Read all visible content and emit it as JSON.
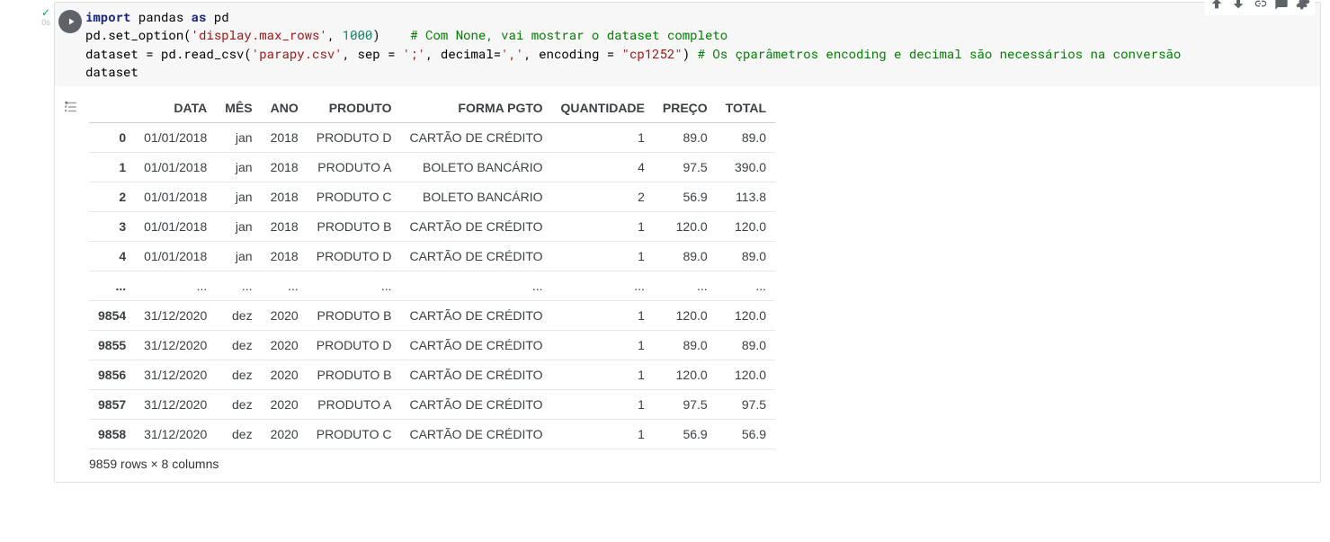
{
  "status": {
    "check": "✓",
    "duration": "0s"
  },
  "toolbar_icons": {
    "up": "arrow-up-icon",
    "down": "arrow-down-icon",
    "link": "link-icon",
    "comment": "comment-icon",
    "settings": "gear-icon"
  },
  "code": {
    "line1_a": "import",
    "line1_b": " pandas ",
    "line1_c": "as",
    "line1_d": " pd",
    "line2_a": "pd.set_option(",
    "line2_b": "'display.max_rows'",
    "line2_c": ", ",
    "line2_d": "1000",
    "line2_e": ")    ",
    "line2_f": "# Com None, vai mostrar o dataset completo",
    "line3_a": "dataset = pd.read_csv(",
    "line3_b": "'parapy.csv'",
    "line3_c": ", sep = ",
    "line3_d": "';'",
    "line3_e": ", decimal=",
    "line3_f": "','",
    "line3_g": ", encoding = ",
    "line3_h": "\"cp1252\"",
    "line3_i": ") ",
    "line3_j": "# Os çparâmetros encoding e decimal são necessários na conversão",
    "line4": "dataset"
  },
  "table": {
    "columns": [
      "",
      "DATA",
      "MÊS",
      "ANO",
      "PRODUTO",
      "FORMA PGTO",
      "QUANTIDADE",
      "PREÇO",
      "TOTAL"
    ],
    "rows": [
      {
        "idx": "0",
        "data": "01/01/2018",
        "mes": "jan",
        "ano": "2018",
        "produto": "PRODUTO D",
        "forma": "CARTÃO DE CRÉDITO",
        "qtd": "1",
        "preco": "89.0",
        "total": "89.0"
      },
      {
        "idx": "1",
        "data": "01/01/2018",
        "mes": "jan",
        "ano": "2018",
        "produto": "PRODUTO A",
        "forma": "BOLETO BANCÁRIO",
        "qtd": "4",
        "preco": "97.5",
        "total": "390.0"
      },
      {
        "idx": "2",
        "data": "01/01/2018",
        "mes": "jan",
        "ano": "2018",
        "produto": "PRODUTO C",
        "forma": "BOLETO BANCÁRIO",
        "qtd": "2",
        "preco": "56.9",
        "total": "113.8"
      },
      {
        "idx": "3",
        "data": "01/01/2018",
        "mes": "jan",
        "ano": "2018",
        "produto": "PRODUTO B",
        "forma": "CARTÃO DE CRÉDITO",
        "qtd": "1",
        "preco": "120.0",
        "total": "120.0"
      },
      {
        "idx": "4",
        "data": "01/01/2018",
        "mes": "jan",
        "ano": "2018",
        "produto": "PRODUTO D",
        "forma": "CARTÃO DE CRÉDITO",
        "qtd": "1",
        "preco": "89.0",
        "total": "89.0"
      },
      {
        "idx": "...",
        "data": "...",
        "mes": "...",
        "ano": "...",
        "produto": "...",
        "forma": "...",
        "qtd": "...",
        "preco": "...",
        "total": "..."
      },
      {
        "idx": "9854",
        "data": "31/12/2020",
        "mes": "dez",
        "ano": "2020",
        "produto": "PRODUTO B",
        "forma": "CARTÃO DE CRÉDITO",
        "qtd": "1",
        "preco": "120.0",
        "total": "120.0"
      },
      {
        "idx": "9855",
        "data": "31/12/2020",
        "mes": "dez",
        "ano": "2020",
        "produto": "PRODUTO D",
        "forma": "CARTÃO DE CRÉDITO",
        "qtd": "1",
        "preco": "89.0",
        "total": "89.0"
      },
      {
        "idx": "9856",
        "data": "31/12/2020",
        "mes": "dez",
        "ano": "2020",
        "produto": "PRODUTO B",
        "forma": "CARTÃO DE CRÉDITO",
        "qtd": "1",
        "preco": "120.0",
        "total": "120.0"
      },
      {
        "idx": "9857",
        "data": "31/12/2020",
        "mes": "dez",
        "ano": "2020",
        "produto": "PRODUTO A",
        "forma": "CARTÃO DE CRÉDITO",
        "qtd": "1",
        "preco": "97.5",
        "total": "97.5"
      },
      {
        "idx": "9858",
        "data": "31/12/2020",
        "mes": "dez",
        "ano": "2020",
        "produto": "PRODUTO C",
        "forma": "CARTÃO DE CRÉDITO",
        "qtd": "1",
        "preco": "56.9",
        "total": "56.9"
      }
    ],
    "summary": "9859 rows × 8 columns"
  }
}
